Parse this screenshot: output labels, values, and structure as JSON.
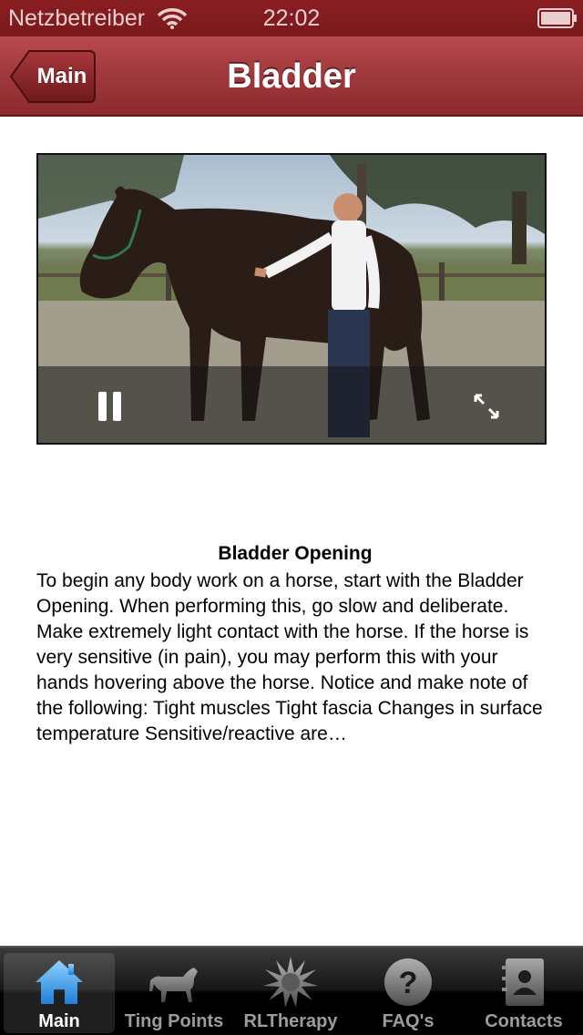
{
  "status_bar": {
    "carrier": "Netzbetreiber",
    "time": "22:02",
    "wifi_icon": "wifi-icon",
    "battery_icon": "battery-icon"
  },
  "nav_bar": {
    "back_label": "Main",
    "title": "Bladder",
    "color": "#a13a3e"
  },
  "video": {
    "state": "playing",
    "pause_icon": "pause-icon",
    "fullscreen_icon": "fullscreen-icon"
  },
  "article": {
    "title": "Bladder Opening",
    "body": "To begin any body work on a horse, start with the Bladder Opening. When performing this, go slow and deliberate. Make extremely light contact with the horse. If the horse is very sensitive (in pain), you may perform this with your hands hovering above the horse. Notice and make note of the following: Tight muscles Tight fascia Changes in surface temperature Sensitive/reactive are…"
  },
  "tab_bar": {
    "selected": "Main",
    "tabs": [
      {
        "label": "Main",
        "icon": "home-icon"
      },
      {
        "label": "Ting Points",
        "icon": "horse-icon"
      },
      {
        "label": "RLTherapy",
        "icon": "burst-icon"
      },
      {
        "label": "FAQ's",
        "icon": "question-icon"
      },
      {
        "label": "Contacts",
        "icon": "contacts-book-icon"
      }
    ],
    "accent": "#3aa0e8"
  }
}
